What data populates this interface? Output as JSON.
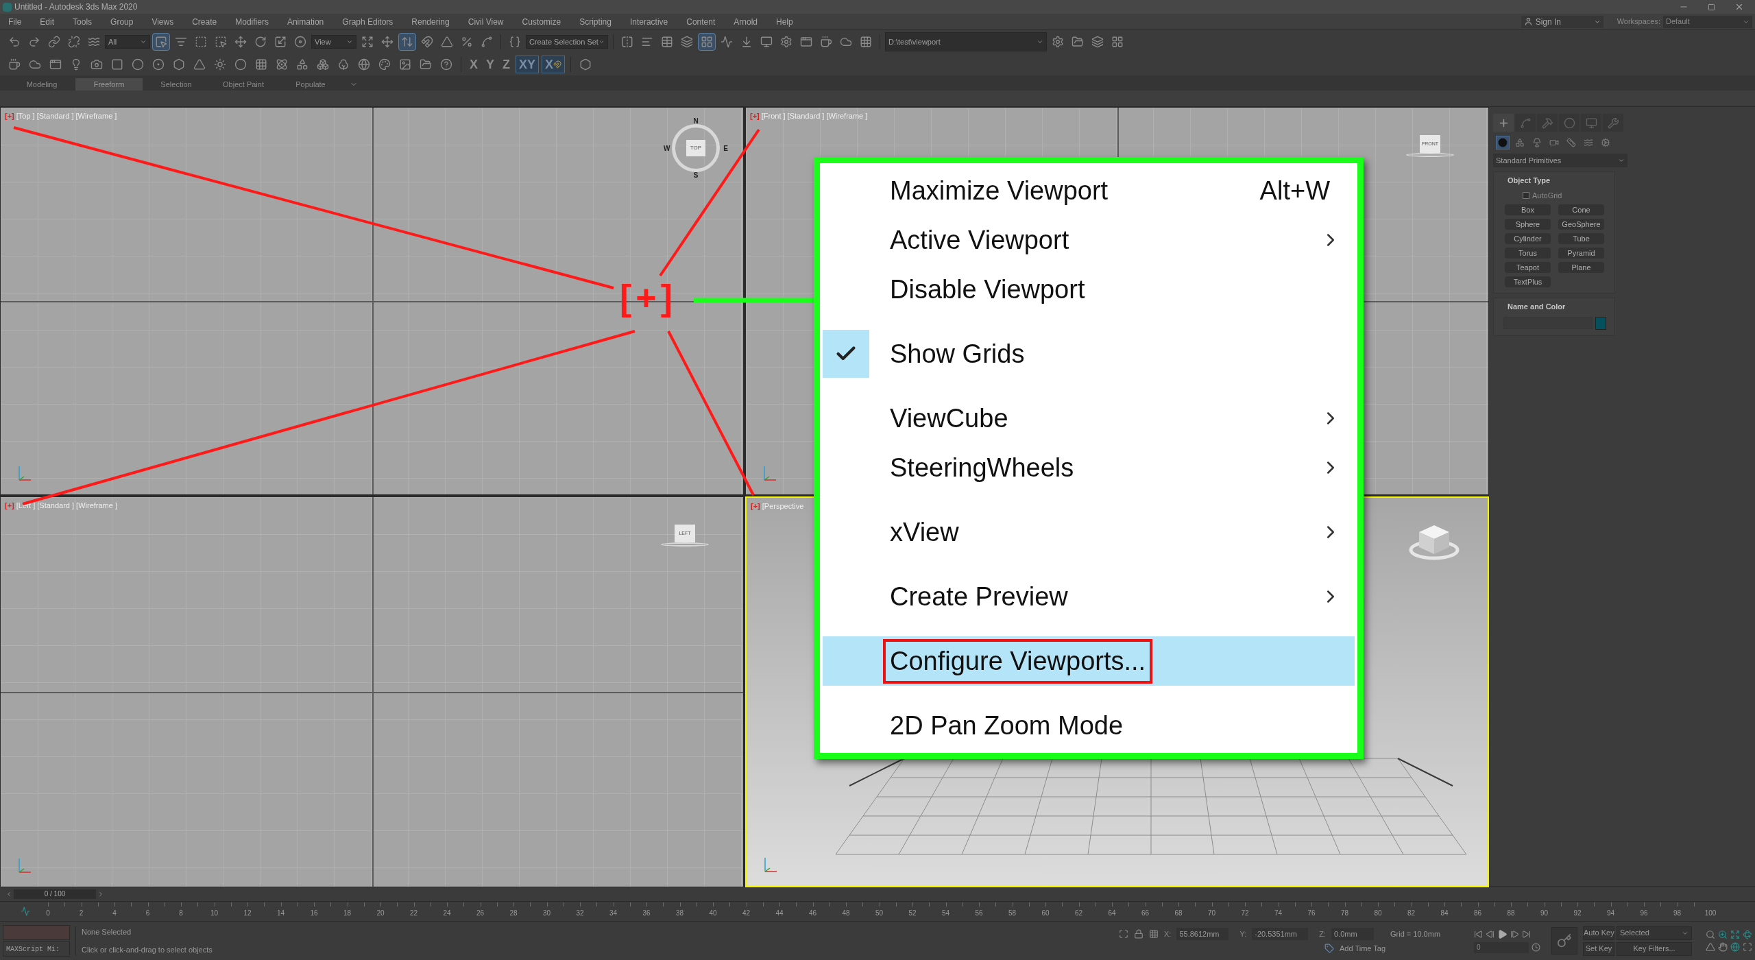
{
  "window": {
    "title": "Untitled - Autodesk 3ds Max 2020"
  },
  "menu_bar": [
    "File",
    "Edit",
    "Tools",
    "Group",
    "Views",
    "Create",
    "Modifiers",
    "Animation",
    "Graph Editors",
    "Rendering",
    "Civil View",
    "Customize",
    "Scripting",
    "Interactive",
    "Content",
    "Arnold",
    "Help"
  ],
  "account": {
    "sign_in": "Sign In",
    "workspaces_label": "Workspaces:",
    "workspace": "Default"
  },
  "main_toolbar": {
    "selection_filter": "All",
    "reference_coordinate": "View",
    "selection_set": "Create Selection Set",
    "project_path": "D:\\test\\viewport"
  },
  "axis_constraints": [
    {
      "label": "X",
      "kind": "axis",
      "selected": false
    },
    {
      "label": "Y",
      "kind": "axis",
      "selected": false
    },
    {
      "label": "Z",
      "kind": "axis",
      "selected": false
    },
    {
      "label": "XY",
      "kind": "axis",
      "selected": true
    },
    {
      "label": "X",
      "kind": "snap",
      "selected": true
    }
  ],
  "ribbon_tabs": [
    {
      "label": "Modeling",
      "selected": false
    },
    {
      "label": "Freeform",
      "selected": true
    },
    {
      "label": "Selection",
      "selected": false
    },
    {
      "label": "Object Paint",
      "selected": false
    },
    {
      "label": "Populate",
      "selected": false
    }
  ],
  "viewports": [
    {
      "kind": "wireframe",
      "labels": [
        "[+]",
        "[Top ]",
        "[Standard ]",
        "[Wireframe ]"
      ],
      "cube_label": "TOP",
      "compass_letters": [
        "N",
        "W",
        "E",
        "S"
      ],
      "active": false
    },
    {
      "kind": "wireframe",
      "labels": [
        "[+]",
        "[Front ]",
        "[Standard ]",
        "[Wireframe ]"
      ],
      "cube_label": "FRONT",
      "active": false
    },
    {
      "kind": "wireframe",
      "labels": [
        "[+]",
        "[Left ]",
        "[Standard ]",
        "[Wireframe ]"
      ],
      "cube_label": "LEFT",
      "active": false
    },
    {
      "kind": "perspective",
      "labels": [
        "[+]",
        "[Perspective"
      ],
      "active": true
    }
  ],
  "annotation": {
    "label": "[+]"
  },
  "context_menu": {
    "items": [
      {
        "kind": "item",
        "label": "Maximize Viewport",
        "shortcut": "Alt+W",
        "submenu": false,
        "checked": false,
        "highlighted": false,
        "framed": false
      },
      {
        "kind": "item",
        "label": "Active Viewport",
        "submenu": true,
        "checked": false,
        "highlighted": false,
        "framed": false
      },
      {
        "kind": "item",
        "label": "Disable Viewport",
        "submenu": false,
        "checked": false,
        "highlighted": false,
        "framed": false
      },
      {
        "kind": "separator"
      },
      {
        "kind": "item",
        "label": "Show Grids",
        "submenu": false,
        "checked": true,
        "highlighted": false,
        "framed": false
      },
      {
        "kind": "separator"
      },
      {
        "kind": "item",
        "label": "ViewCube",
        "submenu": true,
        "checked": false,
        "highlighted": false,
        "framed": false
      },
      {
        "kind": "item",
        "label": "SteeringWheels",
        "submenu": true,
        "checked": false,
        "highlighted": false,
        "framed": false
      },
      {
        "kind": "separator"
      },
      {
        "kind": "item",
        "label": "xView",
        "submenu": true,
        "checked": false,
        "highlighted": false,
        "framed": false
      },
      {
        "kind": "separator"
      },
      {
        "kind": "item",
        "label": "Create Preview",
        "submenu": true,
        "checked": false,
        "highlighted": false,
        "framed": false
      },
      {
        "kind": "separator"
      },
      {
        "kind": "item",
        "label": "Configure Viewports...",
        "submenu": false,
        "checked": false,
        "highlighted": true,
        "framed": true
      },
      {
        "kind": "separator"
      },
      {
        "kind": "item",
        "label": "2D Pan Zoom Mode",
        "submenu": false,
        "checked": false,
        "highlighted": false,
        "framed": false
      }
    ]
  },
  "command_panel": {
    "tabs": [
      {
        "selected": true
      },
      {
        "selected": false
      },
      {
        "selected": false
      },
      {
        "selected": false
      },
      {
        "selected": false
      },
      {
        "selected": false
      }
    ],
    "categories": [
      {
        "selected": true
      },
      {
        "selected": false
      },
      {
        "selected": false
      },
      {
        "selected": false
      },
      {
        "selected": false
      },
      {
        "selected": false
      },
      {
        "selected": false
      }
    ],
    "dropdown": "Standard Primitives",
    "object_type": {
      "title": "Object Type",
      "autogrid": {
        "label": "AutoGrid",
        "checked": false
      },
      "buttons": [
        "Box",
        "Cone",
        "Sphere",
        "GeoSphere",
        "Cylinder",
        "Tube",
        "Torus",
        "Pyramid",
        "Teapot",
        "Plane",
        "TextPlus"
      ]
    },
    "name_and_color": {
      "title": "Name and Color"
    }
  },
  "time_slider": {
    "label": "0 / 100"
  },
  "track_ticks": [
    "0",
    "2",
    "4",
    "6",
    "8",
    "10",
    "12",
    "14",
    "16",
    "18",
    "20",
    "22",
    "24",
    "26",
    "28",
    "30",
    "32",
    "34",
    "36",
    "38",
    "40",
    "42",
    "44",
    "46",
    "48",
    "50",
    "52",
    "54",
    "56",
    "58",
    "60",
    "62",
    "64",
    "66",
    "68",
    "70",
    "72",
    "74",
    "76",
    "78",
    "80",
    "82",
    "84",
    "86",
    "88",
    "90",
    "92",
    "94",
    "96",
    "98",
    "100"
  ],
  "status": {
    "listener": "MAXScript Mi:",
    "selection": "None Selected",
    "prompt": "Click or click-and-drag to select objects",
    "x_label": "X:",
    "x": "55.8612mm",
    "y_label": "Y:",
    "y": "-20.5351mm",
    "z_label": "Z:",
    "z": "0.0mm",
    "grid": "Grid = 10.0mm",
    "time_tag": "Add Time Tag",
    "auto_key": "Auto Key",
    "key_mode": "Selected",
    "set_key": "Set Key",
    "key_filters": "Key Filters...",
    "frame": "0"
  }
}
